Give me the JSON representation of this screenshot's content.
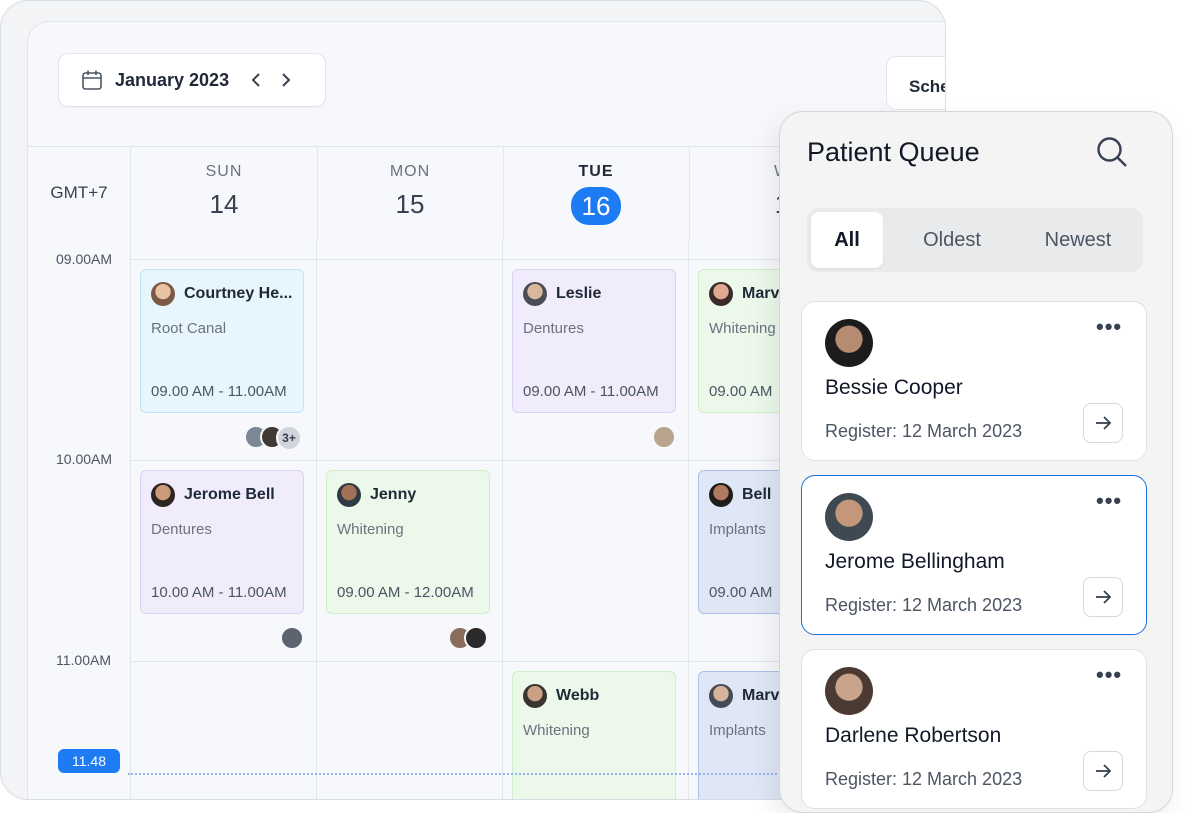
{
  "calendar": {
    "month_label": "January 2023",
    "schedule_label": "Sche",
    "timezone": "GMT+7",
    "days": [
      {
        "dow": "SUN",
        "num": "14"
      },
      {
        "dow": "MON",
        "num": "15"
      },
      {
        "dow": "TUE",
        "num": "16"
      },
      {
        "dow": "W",
        "num": "1"
      }
    ],
    "times": [
      "09.00AM",
      "10.00AM",
      "11.00AM"
    ],
    "now_label": "11.48",
    "appointments": [
      {
        "name": "Courtney He...",
        "procedure": "Root Canal",
        "time": "09.00 AM - 11.00AM"
      },
      {
        "name": "Leslie",
        "procedure": "Dentures",
        "time": "09.00 AM - 11.00AM"
      },
      {
        "name": "Marv",
        "procedure": "Whitening",
        "time": "09.00 AM"
      },
      {
        "name": "Jerome Bell",
        "procedure": "Dentures",
        "time": "10.00 AM - 11.00AM"
      },
      {
        "name": "Jenny",
        "procedure": "Whitening",
        "time": "09.00 AM - 12.00AM"
      },
      {
        "name": "Bell",
        "procedure": "Implants",
        "time": "09.00 AM"
      },
      {
        "name": "Webb",
        "procedure": "Whitening",
        "time": ""
      },
      {
        "name": "Marv",
        "procedure": "Implants",
        "time": ""
      }
    ],
    "more_attendees": "3+"
  },
  "queue": {
    "title": "Patient Queue",
    "filters": [
      "All",
      "Oldest",
      "Newest"
    ],
    "active_filter": "All",
    "patients": [
      {
        "name": "Bessie Cooper",
        "register": "Register: 12 March 2023"
      },
      {
        "name": "Jerome Bellingham",
        "register": "Register: 12 March 2023"
      },
      {
        "name": "Darlene Robertson",
        "register": "Register: 12 March 2023"
      }
    ],
    "more_label": "•••"
  },
  "colors": {
    "accent": "#1d7bf3",
    "card_blue": "#e7f6fc",
    "card_purple": "#f1ecfb",
    "card_green": "#ebf8ea",
    "card_slate": "#dfe6f5"
  }
}
